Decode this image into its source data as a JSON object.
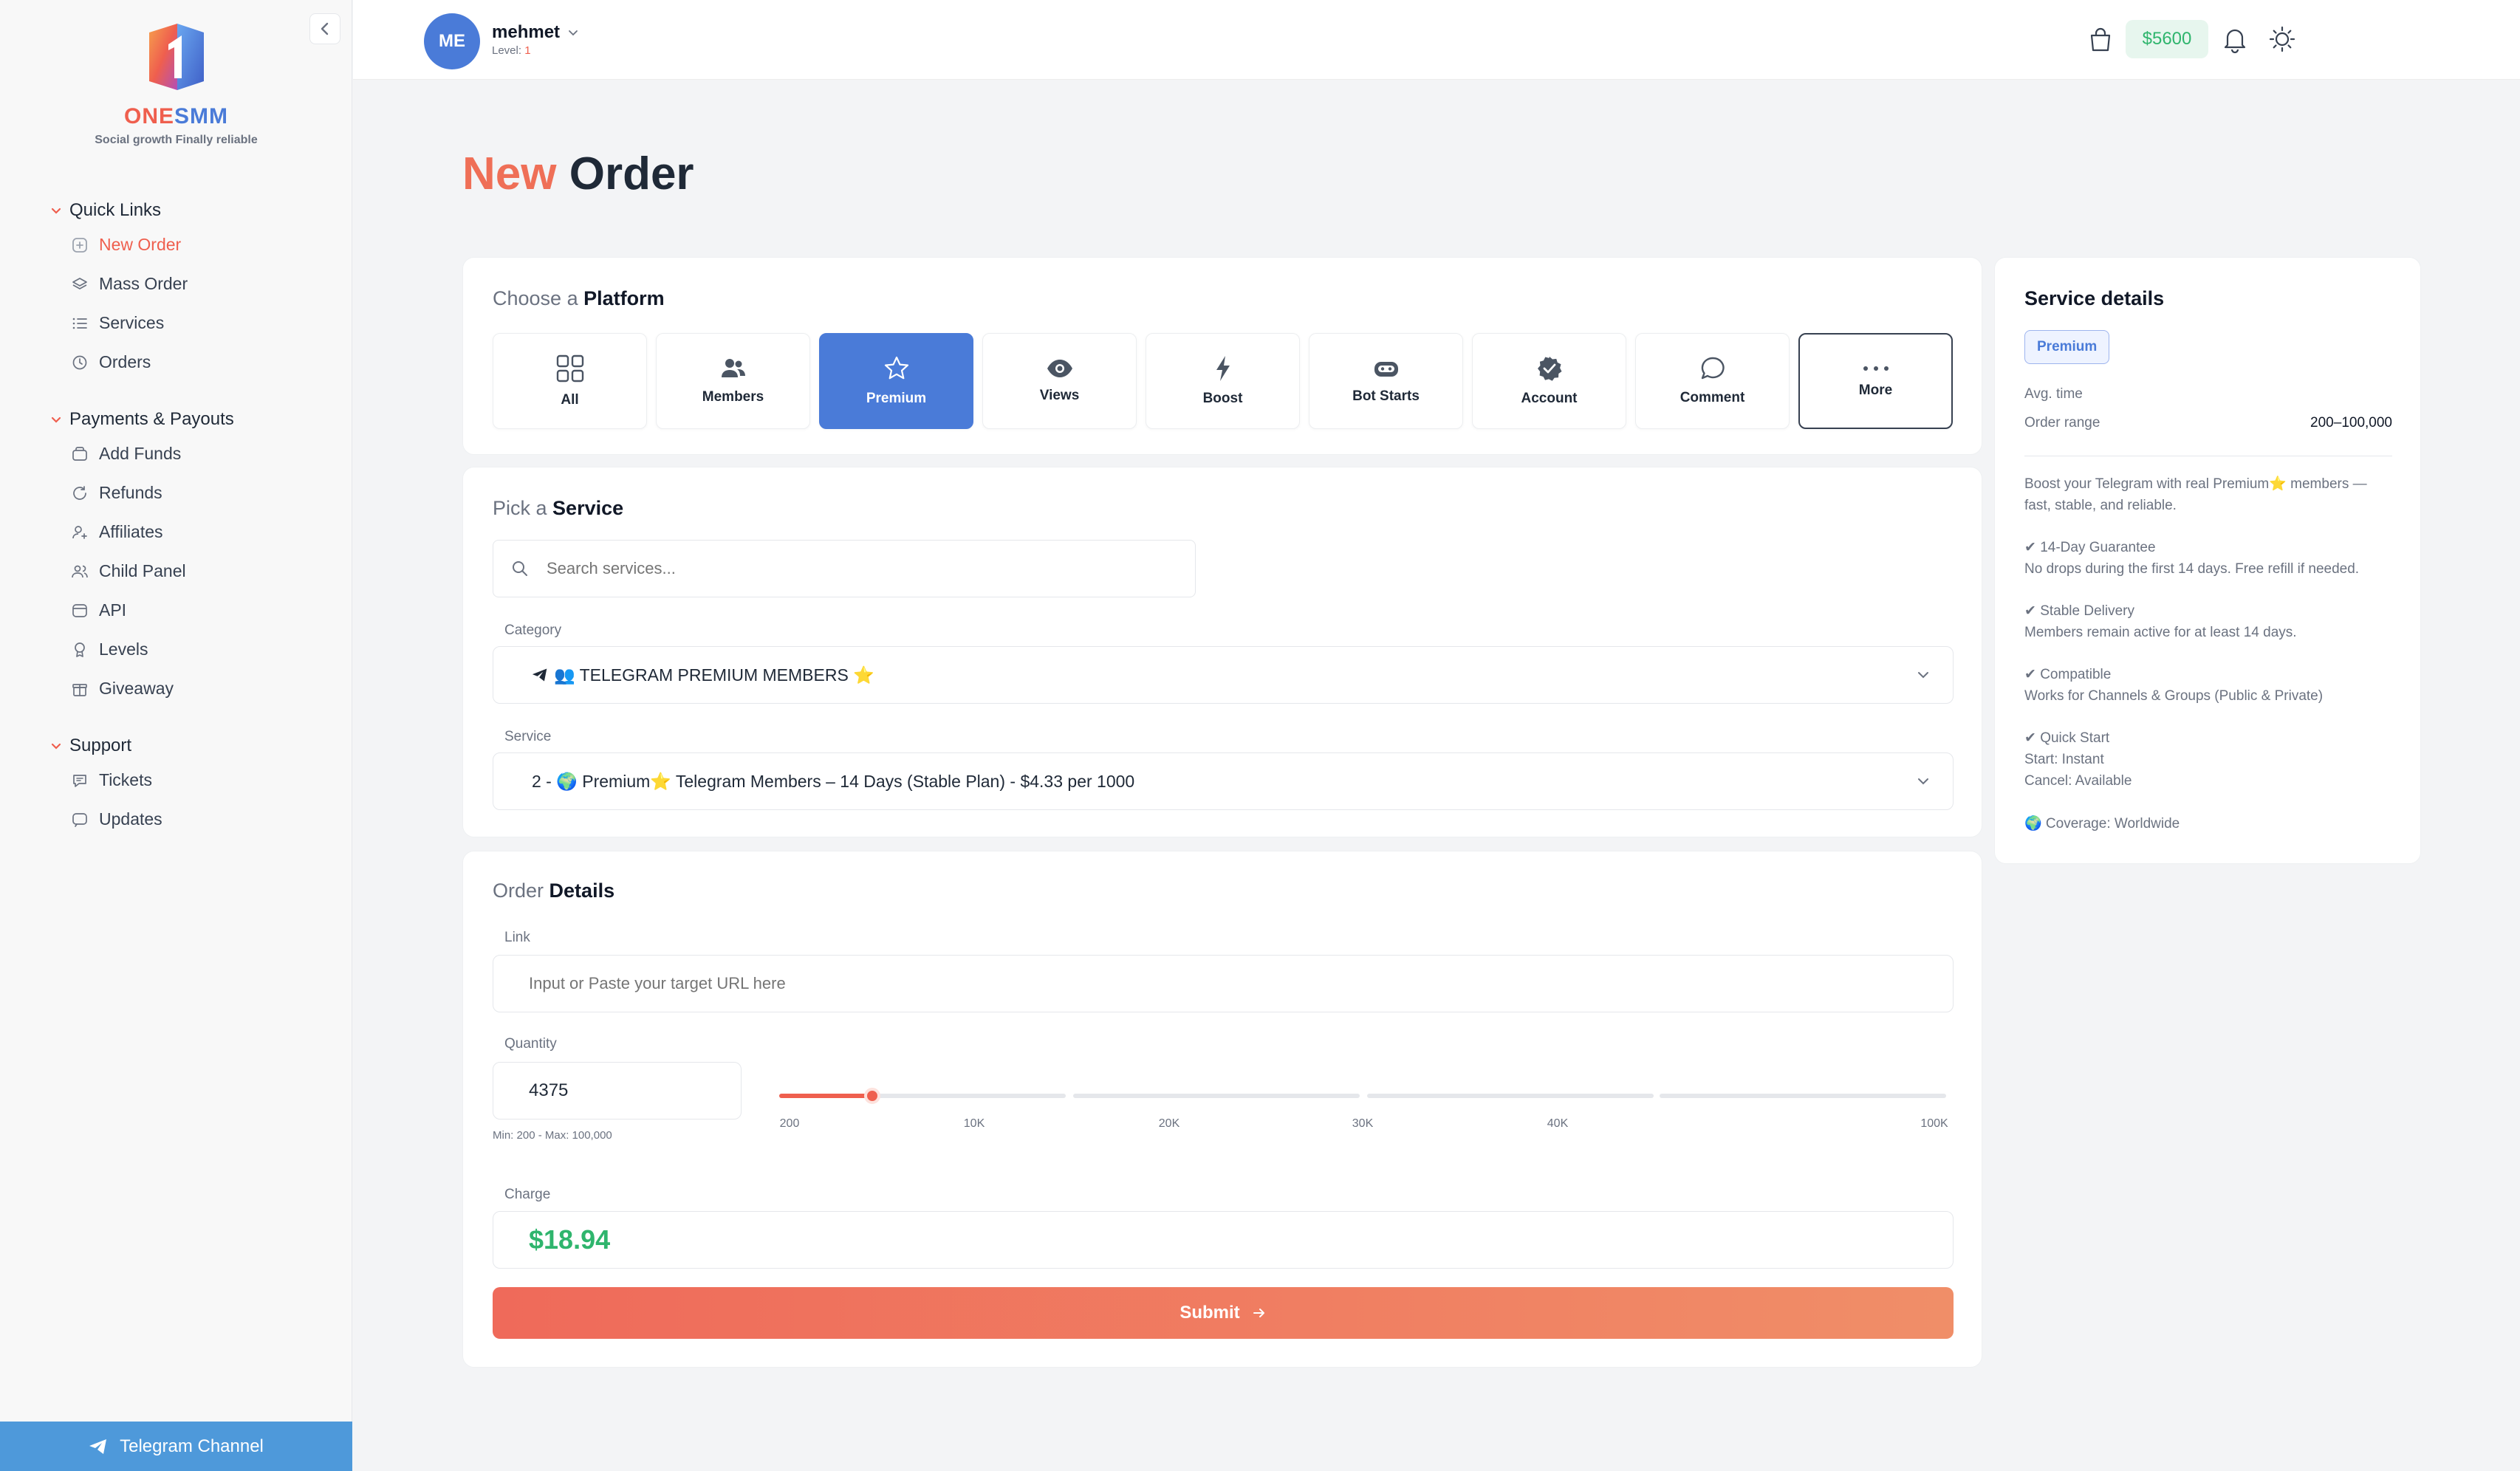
{
  "brand": {
    "name_part1": "ONE",
    "name_part2": "SMM",
    "tagline": "Social growth Finally reliable"
  },
  "sidebar": {
    "groups": [
      {
        "title": "Quick Links",
        "items": [
          {
            "label": "New Order",
            "icon": "plus-square-icon",
            "active": true
          },
          {
            "label": "Mass Order",
            "icon": "layers-icon"
          },
          {
            "label": "Services",
            "icon": "list-icon"
          },
          {
            "label": "Orders",
            "icon": "clock-icon"
          }
        ]
      },
      {
        "title": "Payments & Payouts",
        "items": [
          {
            "label": "Add Funds",
            "icon": "wallet-icon"
          },
          {
            "label": "Refunds",
            "icon": "refresh-icon"
          },
          {
            "label": "Affiliates",
            "icon": "user-share-icon"
          },
          {
            "label": "Child Panel",
            "icon": "users-icon"
          },
          {
            "label": "API",
            "icon": "api-icon"
          },
          {
            "label": "Levels",
            "icon": "award-icon"
          },
          {
            "label": "Giveaway",
            "icon": "gift-icon"
          }
        ]
      },
      {
        "title": "Support",
        "items": [
          {
            "label": "Tickets",
            "icon": "ticket-chat-icon"
          },
          {
            "label": "Updates",
            "icon": "message-icon"
          }
        ]
      }
    ],
    "telegram_button": "Telegram Channel"
  },
  "header": {
    "avatar_initials": "ME",
    "username": "mehmet",
    "level_label": "Level:",
    "level_value": "1",
    "balance": "$5600"
  },
  "page": {
    "title_accent": "New",
    "title_rest": "Order"
  },
  "platform_section": {
    "title_light": "Choose a",
    "title_bold": "Platform",
    "platforms": [
      {
        "label": "All",
        "icon": "grid-icon"
      },
      {
        "label": "Members",
        "icon": "members-icon"
      },
      {
        "label": "Premium",
        "icon": "star-icon",
        "active": true
      },
      {
        "label": "Views",
        "icon": "eye-icon"
      },
      {
        "label": "Boost",
        "icon": "bolt-icon"
      },
      {
        "label": "Bot Starts",
        "icon": "bot-icon"
      },
      {
        "label": "Account",
        "icon": "verified-icon"
      },
      {
        "label": "Comment",
        "icon": "comment-icon"
      },
      {
        "label": "More",
        "icon": "ellipsis-icon"
      }
    ]
  },
  "service_section": {
    "title_light": "Pick a",
    "title_bold": "Service",
    "search_placeholder": "Search services...",
    "category_label": "Category",
    "category_value": "👥 TELEGRAM PREMIUM MEMBERS ⭐",
    "service_label": "Service",
    "service_value": "2 - 🌍 Premium⭐ Telegram Members – 14 Days (Stable Plan) - $4.33 per 1000"
  },
  "order_section": {
    "title_light": "Order",
    "title_bold": "Details",
    "link_label": "Link",
    "link_placeholder": "Input or Paste your target URL here",
    "quantity_label": "Quantity",
    "quantity_value": "4375",
    "quantity_hint": "Min: 200 - Max: 100,000",
    "slider_ticks": [
      "200",
      "10K",
      "20K",
      "30K",
      "40K",
      "100K"
    ],
    "slider_fraction": 0.08,
    "charge_label": "Charge",
    "charge_value": "$18.94",
    "submit_label": "Submit"
  },
  "details": {
    "title": "Service details",
    "badge": "Premium",
    "avg_time_label": "Avg. time",
    "avg_time_value": "",
    "order_range_label": "Order range",
    "order_range_value": "200–100,000",
    "description": "Boost your Telegram with real Premium⭐ members — fast, stable, and reliable.",
    "features": [
      {
        "title": "✔ 14-Day Guarantee",
        "lines": [
          "No drops during the first 14 days. Free refill if needed."
        ]
      },
      {
        "title": "✔ Stable Delivery",
        "lines": [
          "Members remain active for at least 14 days."
        ]
      },
      {
        "title": "✔ Compatible",
        "lines": [
          "Works for Channels & Groups (Public & Private)"
        ]
      },
      {
        "title": "✔ Quick Start",
        "lines": [
          "Start: Instant",
          "Cancel: Available"
        ]
      }
    ],
    "coverage": "🌍 Coverage: Worldwide"
  },
  "colors": {
    "accent": "#ef5f4e",
    "brand_blue": "#4a7bd8",
    "success": "#2fb56d",
    "telegram": "#4e99da"
  }
}
